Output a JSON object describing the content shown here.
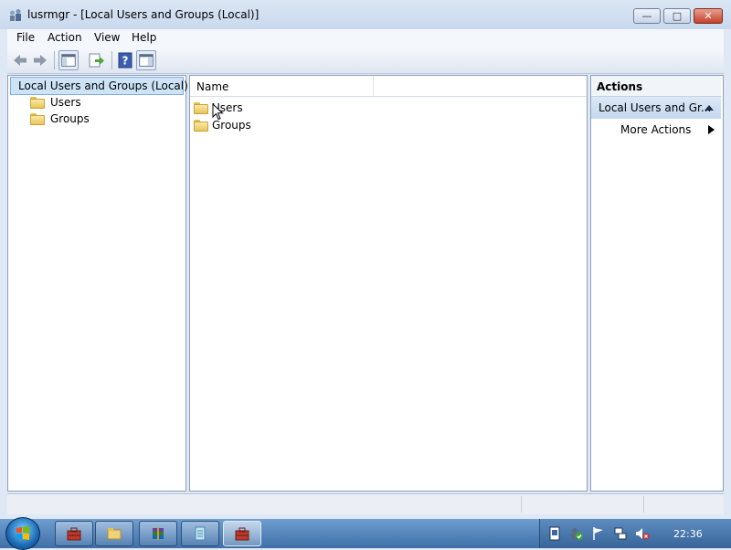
{
  "window": {
    "title": "lusrmgr - [Local Users and Groups (Local)]",
    "controls": {
      "minimize": "—",
      "maximize": "□",
      "close": "✕"
    }
  },
  "menu": {
    "file": "File",
    "action": "Action",
    "view": "View",
    "help": "Help"
  },
  "toolbar": {
    "icons": [
      "back-arrow-icon",
      "forward-arrow-icon",
      "show-hide-console-tree-icon",
      "export-list-icon",
      "help-icon",
      "show-hide-action-pane-icon"
    ]
  },
  "tree": {
    "root": "Local Users and Groups (Local)",
    "children": [
      "Users",
      "Groups"
    ]
  },
  "list": {
    "column_name": "Name",
    "items": [
      "Users",
      "Groups"
    ]
  },
  "actions": {
    "header": "Actions",
    "group_title": "Local Users and Gr...",
    "more_actions": "More Actions"
  },
  "taskbar": {
    "clock": "22:36"
  },
  "colors": {
    "selection": "#cde4f7",
    "title_bar": "#c9d9ee",
    "taskbar": "#3e6fa6"
  }
}
